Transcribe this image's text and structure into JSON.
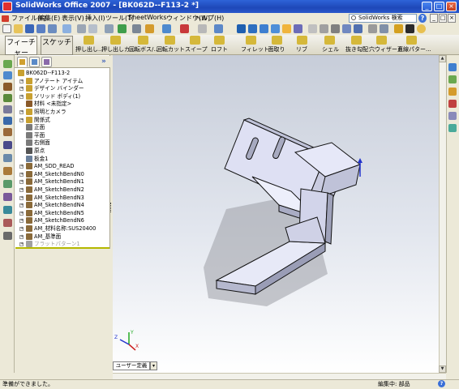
{
  "window": {
    "title": "SolidWorks Office 2007 - [BK062D--F113-2 *]",
    "buttons": [
      "_",
      "□",
      "×"
    ]
  },
  "menu": {
    "items": [
      "ファイル(F)",
      "編集(E)",
      "表示(V)",
      "挿入(I)",
      "ツール(T)",
      "SheetWorks",
      "ウィンドウ(W)",
      "ヘルプ(H)"
    ],
    "search_placeholder": "SolidWorks 検索",
    "help_label": "?",
    "mdi_buttons": [
      "_",
      "□",
      "×"
    ]
  },
  "command_manager": {
    "items": [
      {
        "label": "フィーチャー",
        "icon": "feature-tab-icon",
        "color": "#6AA84F"
      },
      {
        "label": "スケッチ",
        "icon": "sketch-tab-icon",
        "color": "#E69138"
      },
      {
        "label": "押し出し...",
        "icon": "extrude-boss-icon",
        "color": "#D5B83A"
      },
      {
        "label": "押し出しカ...",
        "icon": "extrude-cut-icon",
        "color": "#D5B83A"
      },
      {
        "label": "回転ボス/...",
        "icon": "revolve-boss-icon",
        "color": "#D5B83A"
      },
      {
        "label": "回転カット",
        "icon": "revolve-cut-icon",
        "color": "#D5B83A"
      },
      {
        "label": "スイープ",
        "icon": "sweep-icon",
        "color": "#D5B83A"
      },
      {
        "label": "ロフト",
        "icon": "loft-icon",
        "color": "#D5B83A"
      },
      {
        "label": "フィレット",
        "icon": "fillet-icon",
        "color": "#D5B83A"
      },
      {
        "label": "面取り",
        "icon": "chamfer-icon",
        "color": "#D5B83A"
      },
      {
        "label": "リブ",
        "icon": "rib-icon",
        "color": "#D5B83A"
      },
      {
        "label": "シェル",
        "icon": "shell-icon",
        "color": "#D5B83A"
      },
      {
        "label": "抜き勾配",
        "icon": "draft-icon",
        "color": "#D5B83A"
      },
      {
        "label": "穴ウィザード",
        "icon": "hole-wizard-icon",
        "color": "#D5B83A"
      },
      {
        "label": "直線パター...",
        "icon": "linear-pattern-icon",
        "color": "#D5B83A"
      }
    ]
  },
  "feature_manager": {
    "collapse_label": "»",
    "items": [
      {
        "label": "BK062D--F113-2",
        "icon": "part-icon",
        "expandable": false,
        "color": "#C8A030"
      },
      {
        "label": "アノテート アイテム",
        "icon": "annotations-icon",
        "expandable": true,
        "color": "#C8A030"
      },
      {
        "label": "デザイン バインダー",
        "icon": "design-binder-icon",
        "expandable": true,
        "color": "#C8A030"
      },
      {
        "label": "ソリッド ボディ(1)",
        "icon": "solid-bodies-icon",
        "expandable": true,
        "color": "#C8A030"
      },
      {
        "label": "材料 <未指定>",
        "icon": "material-icon",
        "expandable": false,
        "color": "#8A5A2A"
      },
      {
        "label": "照明とカメラ",
        "icon": "lights-cameras-icon",
        "expandable": true,
        "color": "#C8A030"
      },
      {
        "label": "関係式",
        "icon": "equations-icon",
        "expandable": true,
        "color": "#C8A030"
      },
      {
        "label": "正面",
        "icon": "plane-icon",
        "expandable": false,
        "color": "#7A7A7A"
      },
      {
        "label": "平面",
        "icon": "plane-icon",
        "expandable": false,
        "color": "#7A7A7A"
      },
      {
        "label": "右側面",
        "icon": "plane-icon",
        "expandable": false,
        "color": "#7A7A7A"
      },
      {
        "label": "原点",
        "icon": "origin-icon",
        "expandable": false,
        "color": "#555555"
      },
      {
        "label": "板金1",
        "icon": "sheet-metal-icon",
        "expandable": false,
        "color": "#6A7F9A"
      },
      {
        "label": "AM_SDD_READ",
        "icon": "custom-feature-icon",
        "expandable": true,
        "color": "#8A6A3A"
      },
      {
        "label": "AM_SketchBendN0",
        "icon": "custom-feature-icon",
        "expandable": true,
        "color": "#8A6A3A"
      },
      {
        "label": "AM_SketchBendN1",
        "icon": "custom-feature-icon",
        "expandable": true,
        "color": "#8A6A3A"
      },
      {
        "label": "AM_SketchBendN2",
        "icon": "custom-feature-icon",
        "expandable": true,
        "color": "#8A6A3A"
      },
      {
        "label": "AM_SketchBendN3",
        "icon": "custom-feature-icon",
        "expandable": true,
        "color": "#8A6A3A"
      },
      {
        "label": "AM_SketchBendN4",
        "icon": "custom-feature-icon",
        "expandable": true,
        "color": "#8A6A3A"
      },
      {
        "label": "AM_SketchBendN5",
        "icon": "custom-feature-icon",
        "expandable": true,
        "color": "#8A6A3A"
      },
      {
        "label": "AM_SketchBendN6",
        "icon": "custom-feature-icon",
        "expandable": true,
        "color": "#8A6A3A"
      },
      {
        "label": "AM_材料名称:SUS20400",
        "icon": "custom-feature-icon",
        "expandable": true,
        "color": "#8A6A3A"
      },
      {
        "label": "AM_基準面",
        "icon": "custom-feature-icon",
        "expandable": true,
        "color": "#8A6A3A"
      },
      {
        "label": "フラットパターン1",
        "icon": "flat-pattern-icon",
        "expandable": true,
        "color": "#A0A0A0",
        "suppressed": true
      }
    ]
  },
  "viewport": {
    "view_orientation_label": "ユーザー定義",
    "triad": {
      "x": "X",
      "y": "Y",
      "z": "Z"
    }
  },
  "status_bar": {
    "left_text": "準備ができました。",
    "right_text": "編集中: 部品",
    "help_label": "?"
  },
  "colors": {
    "titlebar": "#1E48B8",
    "chrome": "#ECE9D8",
    "part_face": "#E2E4F6",
    "part_edge": "#1A1A1A"
  }
}
